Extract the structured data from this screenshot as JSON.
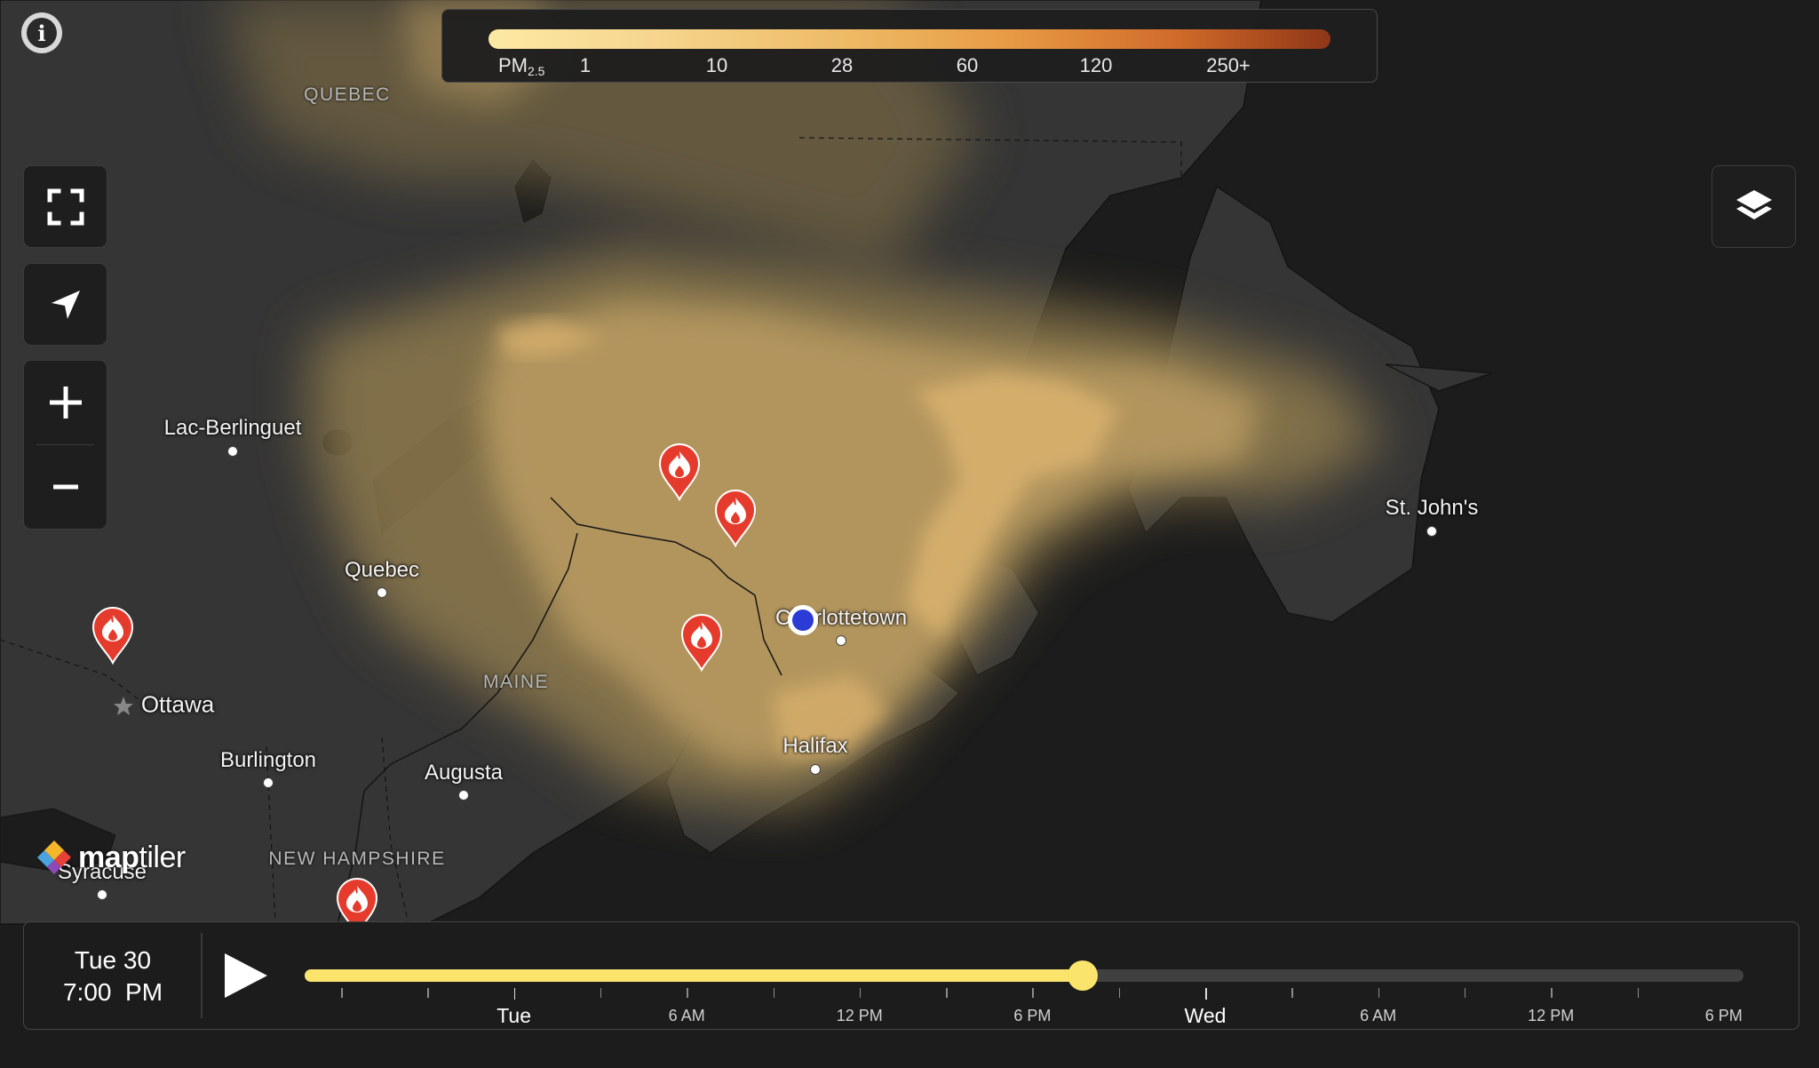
{
  "legend": {
    "pollutant": "PM",
    "pollutant_sub": "2.5",
    "scale_labels": [
      "1",
      "10",
      "28",
      "60",
      "120",
      "250+"
    ]
  },
  "map": {
    "places": [
      {
        "name": "Lac-Berlinguet"
      },
      {
        "name": "Quebec"
      },
      {
        "name": "Ottawa"
      },
      {
        "name": "Burlington"
      },
      {
        "name": "Augusta"
      },
      {
        "name": "Syracuse"
      },
      {
        "name": "Charlottetown"
      },
      {
        "name": "Halifax"
      },
      {
        "name": "St. John's"
      }
    ],
    "regions": [
      {
        "name": "QUEBEC"
      },
      {
        "name": "MAINE"
      },
      {
        "name": "NEW HAMPSHIRE"
      }
    ],
    "fire_markers": 5,
    "attribution_logo": {
      "light": "map",
      "bold": "tiler",
      "pre": "map",
      "post": "tiler"
    }
  },
  "colors": {
    "accent_yellow": "#fbe46c",
    "fire_marker": "#e53b2c",
    "location_dot": "#2b3bd6",
    "panel_bg": "#1e1e1e"
  },
  "controls": {
    "info_glyph": "i",
    "icons": [
      "info-icon",
      "fullscreen-icon",
      "locate-arrow-icon",
      "zoom-in-icon",
      "zoom-out-icon",
      "layers-icon",
      "play-icon",
      "fire-icon"
    ]
  },
  "timeline": {
    "date": "Tue 30",
    "time": "7:00  PM",
    "progress_fraction": 0.541,
    "labels": [
      "Tue",
      "6 AM",
      "12 PM",
      "6 PM",
      "Wed",
      "6 AM",
      "12 PM",
      "6 PM"
    ]
  }
}
